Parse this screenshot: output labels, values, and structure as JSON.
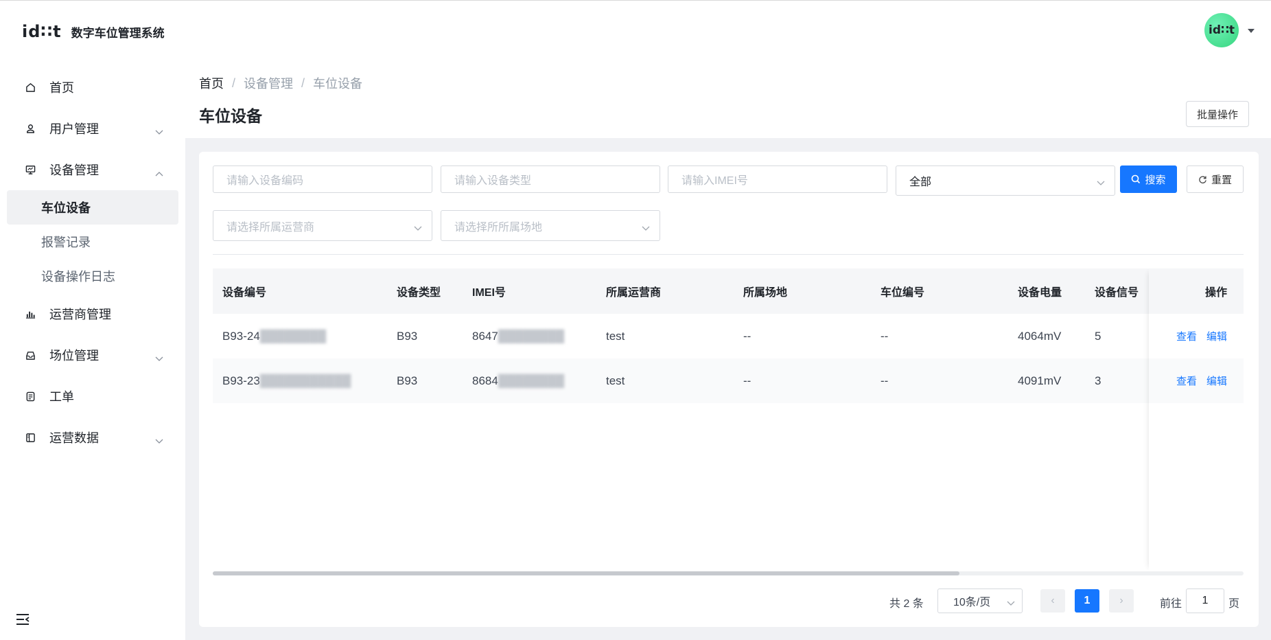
{
  "app": {
    "logo_text": "id∷t",
    "name": "数字车位管理系统"
  },
  "user": {
    "avatar_text": "id∷t"
  },
  "sidebar": {
    "items": [
      {
        "label": "首页",
        "icon": "home-icon"
      },
      {
        "label": "用户管理",
        "icon": "user-icon",
        "expandable": true
      },
      {
        "label": "设备管理",
        "icon": "monitor-icon",
        "expanded": true,
        "children": [
          {
            "label": "车位设备",
            "active": true
          },
          {
            "label": "报警记录"
          },
          {
            "label": "设备操作日志"
          }
        ]
      },
      {
        "label": "运营商管理",
        "icon": "bar-chart-icon"
      },
      {
        "label": "场位管理",
        "icon": "inbox-icon",
        "expandable": true
      },
      {
        "label": "工单",
        "icon": "document-icon"
      },
      {
        "label": "运营数据",
        "icon": "panel-icon",
        "expandable": true
      }
    ]
  },
  "breadcrumb": [
    "首页",
    "设备管理",
    "车位设备"
  ],
  "page": {
    "title": "车位设备",
    "batch_label": "批量操作"
  },
  "filters": {
    "device_code_placeholder": "请输入设备编码",
    "device_type_placeholder": "请输入设备类型",
    "imei_placeholder": "请输入IMEI号",
    "status_value": "全部",
    "operator_placeholder": "请选择所属运营商",
    "site_placeholder": "请选择所所属场地",
    "search_label": "搜索",
    "reset_label": "重置"
  },
  "table": {
    "columns": [
      "设备编号",
      "设备类型",
      "IMEI号",
      "所属运营商",
      "所属场地",
      "车位编号",
      "设备电量",
      "设备信号",
      "操作"
    ],
    "rows": [
      {
        "code_prefix": "B93-24",
        "code_hidden": "████████",
        "type": "B93",
        "imei_prefix": "8647",
        "imei_hidden": "████████",
        "operator": "test",
        "site": "--",
        "slot": "--",
        "battery": "4064mV",
        "signal": "5"
      },
      {
        "code_prefix": "B93-23",
        "code_hidden": "███████████",
        "type": "B93",
        "imei_prefix": "8684",
        "imei_hidden": "████████",
        "operator": "test",
        "site": "--",
        "slot": "--",
        "battery": "4091mV",
        "signal": "3"
      }
    ],
    "actions": {
      "view": "查看",
      "edit": "编辑"
    }
  },
  "pagination": {
    "total_text": "共 2 条",
    "page_size": "10条/页",
    "current_page": "1",
    "goto_label": "前往",
    "goto_value": "1",
    "goto_unit": "页",
    "prev_symbol": "‹",
    "next_symbol": "›"
  },
  "colors": {
    "primary": "#1677ff",
    "avatar": "#3ddc84"
  }
}
